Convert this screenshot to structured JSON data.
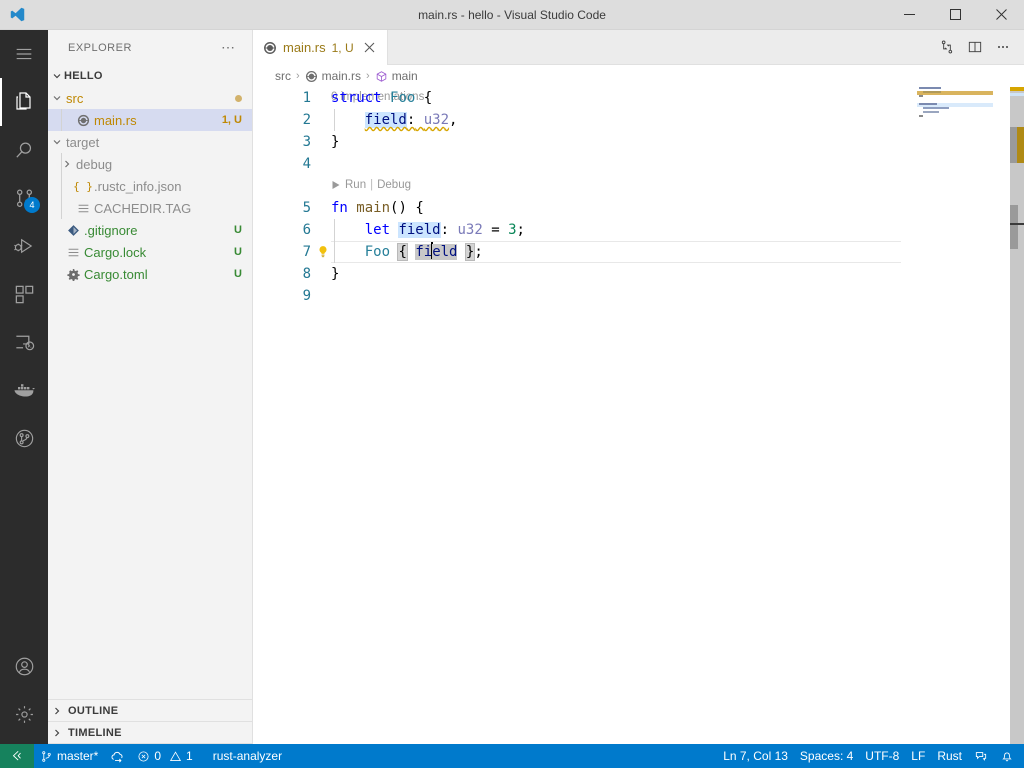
{
  "window": {
    "title": "main.rs - hello - Visual Studio Code",
    "logo_icon": "vscode-logo-icon",
    "controls": {
      "minimize": "minimize-icon",
      "maximize": "maximize-icon",
      "close": "close-icon"
    }
  },
  "activitybar": {
    "items": [
      {
        "name": "menu",
        "icon": "hamburger-menu-icon",
        "badge": ""
      },
      {
        "name": "explorer",
        "icon": "files-icon",
        "badge": ""
      },
      {
        "name": "search",
        "icon": "search-icon",
        "badge": ""
      },
      {
        "name": "source-control",
        "icon": "source-control-icon",
        "badge": "4"
      },
      {
        "name": "run-and-debug",
        "icon": "run-debug-icon",
        "badge": ""
      },
      {
        "name": "extensions",
        "icon": "extensions-icon",
        "badge": ""
      },
      {
        "name": "remote-explorer",
        "icon": "remote-explorer-icon",
        "badge": ""
      },
      {
        "name": "docker",
        "icon": "docker-whale-icon",
        "badge": ""
      },
      {
        "name": "git-graph",
        "icon": "git-graph-icon",
        "badge": ""
      }
    ],
    "bottom": [
      {
        "name": "accounts",
        "icon": "account-icon"
      },
      {
        "name": "manage",
        "icon": "gear-icon"
      }
    ]
  },
  "sidebar": {
    "header": "EXPLORER",
    "actions_icon": "ellipsis-icon",
    "root": {
      "label": "HELLO",
      "expanded": true,
      "twisty": "chevron-down-icon"
    },
    "tree": [
      {
        "label": "src",
        "depth": 1,
        "type": "folder",
        "expanded": true,
        "twisty": "chevron-down-icon",
        "deco": "",
        "deco_dot": true,
        "color": "gold",
        "icon": ""
      },
      {
        "label": "main.rs",
        "depth": 2,
        "type": "file",
        "selected": true,
        "twisty": "",
        "deco": "1, U",
        "deco_dot": false,
        "color": "gold",
        "icon": "rust-icon"
      },
      {
        "label": "target",
        "depth": 1,
        "type": "folder",
        "expanded": true,
        "twisty": "chevron-down-icon",
        "deco": "",
        "deco_dot": false,
        "color": "gray",
        "icon": ""
      },
      {
        "label": "debug",
        "depth": 2,
        "type": "folder",
        "expanded": false,
        "twisty": "chevron-right-icon",
        "deco": "",
        "deco_dot": false,
        "color": "gray",
        "icon": ""
      },
      {
        "label": ".rustc_info.json",
        "depth": 2,
        "type": "file",
        "twisty": "",
        "deco": "",
        "deco_dot": false,
        "color": "gray",
        "icon": "json-icon"
      },
      {
        "label": "CACHEDIR.TAG",
        "depth": 2,
        "type": "file",
        "twisty": "",
        "deco": "",
        "deco_dot": false,
        "color": "gray",
        "icon": "text-file-icon"
      },
      {
        "label": ".gitignore",
        "depth": 1,
        "type": "file",
        "twisty": "",
        "deco": "U",
        "deco_dot": false,
        "color": "green",
        "icon": "git-icon"
      },
      {
        "label": "Cargo.lock",
        "depth": 1,
        "type": "file",
        "twisty": "",
        "deco": "U",
        "deco_dot": false,
        "color": "green",
        "icon": "text-file-icon"
      },
      {
        "label": "Cargo.toml",
        "depth": 1,
        "type": "file",
        "twisty": "",
        "deco": "U",
        "deco_dot": false,
        "color": "green",
        "icon": "gear-file-icon"
      }
    ],
    "collapsed_sections": [
      {
        "label": "OUTLINE",
        "twisty": "chevron-right-icon"
      },
      {
        "label": "TIMELINE",
        "twisty": "chevron-right-icon"
      }
    ]
  },
  "editor": {
    "tab": {
      "icon": "rust-icon",
      "label": "main.rs",
      "decoration": "1, U",
      "close_icon": "close-icon"
    },
    "actions": [
      {
        "name": "split-in-group",
        "icon": "diff-editor-icon"
      },
      {
        "name": "split-editor-right",
        "icon": "split-editor-icon"
      },
      {
        "name": "more-actions",
        "icon": "ellipsis-icon"
      }
    ],
    "breadcrumbs": [
      {
        "label": "src",
        "icon": ""
      },
      {
        "label": "main.rs",
        "icon": "rust-icon"
      },
      {
        "label": "main",
        "icon": "symbol-function-icon"
      }
    ],
    "breadcrumb_separator": "›",
    "codelens_implementations": "0 implementations",
    "codelens_run": "Run",
    "codelens_debug": "Debug",
    "codelens_separator": "|",
    "run_icon": "play-triangle-icon",
    "lightbulb_icon": "lightbulb-icon",
    "line_numbers": [
      "1",
      "2",
      "3",
      "4",
      "5",
      "6",
      "7",
      "8",
      "9"
    ],
    "lines": [
      {
        "n": "1",
        "text": "struct Foo {"
      },
      {
        "n": "2",
        "text": "    field: u32,"
      },
      {
        "n": "3",
        "text": "}"
      },
      {
        "n": "4",
        "text": ""
      },
      {
        "n": "5",
        "text": "fn main() {"
      },
      {
        "n": "6",
        "text": "    let field: u32 = 3;"
      },
      {
        "n": "7",
        "text": "    Foo { field };"
      },
      {
        "n": "8",
        "text": "}"
      },
      {
        "n": "9",
        "text": ""
      }
    ],
    "language": "Rust",
    "colors": {
      "keyword": "#0000ff",
      "type": "#267f99",
      "function": "#795e26",
      "variable": "#001080",
      "number": "#098658",
      "occurrence_highlight": "#cce5ff",
      "selection": "#c8c8c8",
      "warning_squiggle": "#d6a500"
    }
  },
  "statusbar": {
    "remote_icon": "remote-window-icon",
    "left": [
      {
        "name": "branch",
        "icon": "git-branch-icon",
        "label": "master*"
      },
      {
        "name": "sync",
        "icon": "sync-cloud-icon",
        "label": ""
      },
      {
        "name": "problems",
        "icon": "error-warning-icon",
        "label": "0",
        "label2": "1",
        "error_icon": "error-circle-icon",
        "warning_icon": "warning-triangle-icon"
      },
      {
        "name": "language-server",
        "icon": "",
        "label": "rust-analyzer"
      }
    ],
    "right": [
      {
        "name": "cursor-position",
        "label": "Ln 7, Col 13"
      },
      {
        "name": "indentation",
        "label": "Spaces: 4"
      },
      {
        "name": "encoding",
        "label": "UTF-8"
      },
      {
        "name": "eol",
        "label": "LF"
      },
      {
        "name": "language-mode",
        "label": "Rust"
      },
      {
        "name": "live-share",
        "icon": "live-share-icon",
        "label": ""
      },
      {
        "name": "notifications",
        "icon": "bell-icon",
        "label": ""
      }
    ],
    "accent_color": "#007acc",
    "remote_color": "#16825d"
  }
}
